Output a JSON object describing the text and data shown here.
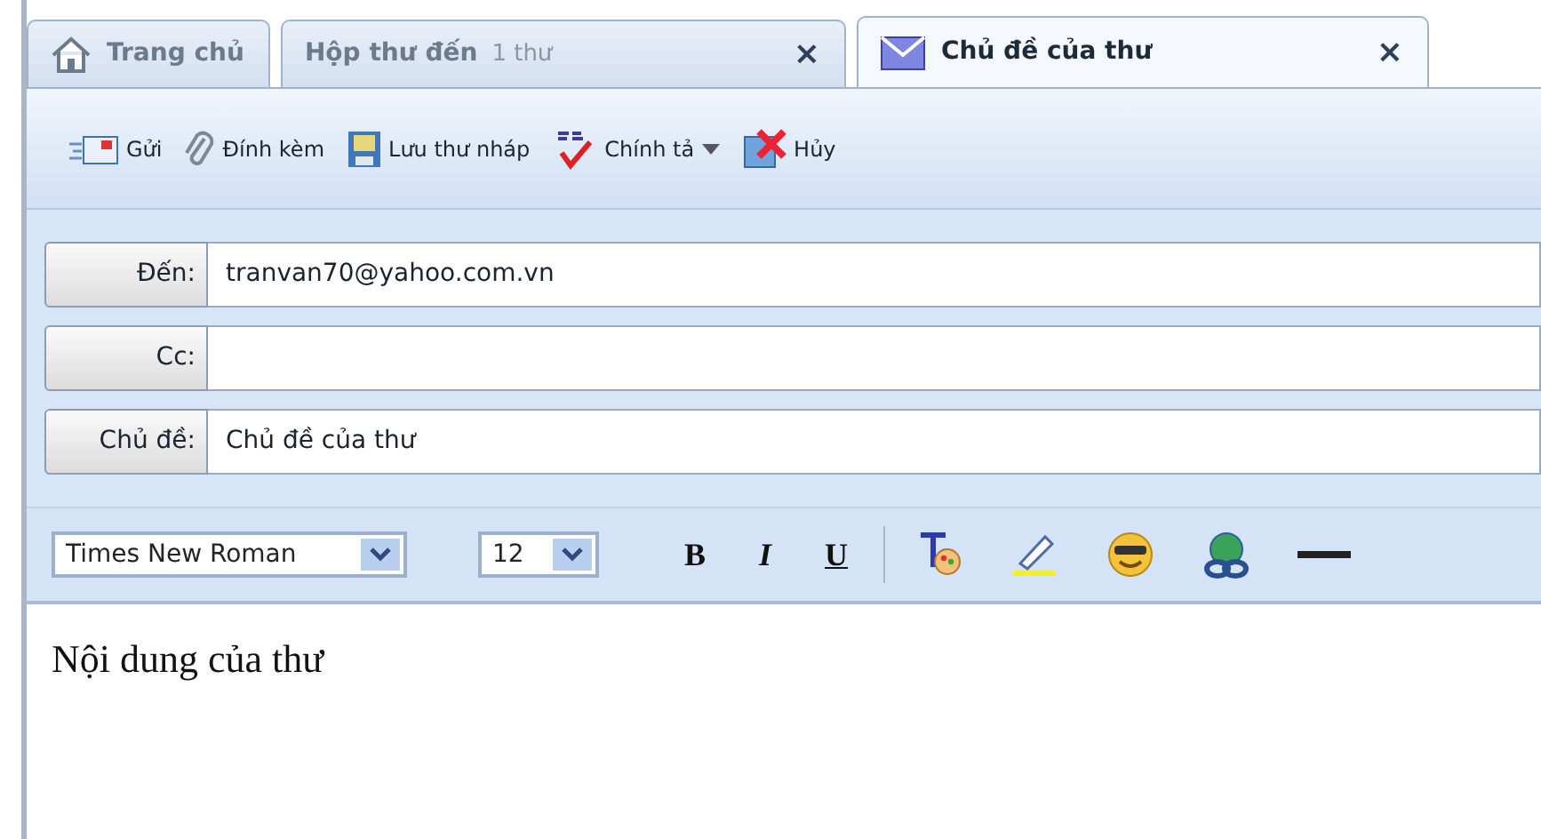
{
  "tabs": [
    {
      "kind": "home",
      "label": "Trang chủ",
      "selected": false
    },
    {
      "kind": "folder",
      "label": "Hộp thư đến",
      "count": "1 thư",
      "close": "×",
      "selected": false
    },
    {
      "kind": "message",
      "label": "Chủ đề của thư",
      "close": "×",
      "selected": true
    }
  ],
  "toolbar": [
    {
      "kind": "send",
      "label": "Gửi",
      "menu": false
    },
    {
      "kind": "attach",
      "label": "Đính kèm",
      "menu": false
    },
    {
      "kind": "save",
      "label": "Lưu thư nháp",
      "menu": false
    },
    {
      "kind": "spell",
      "label": "Chính tả",
      "menu": true
    },
    {
      "kind": "cancel",
      "label": "Hủy",
      "menu": false
    }
  ],
  "fields": [
    {
      "label": "Đến:",
      "value": "tranvan70@yahoo.com.vn"
    },
    {
      "label": "Cc:"
    },
    {
      "label": "Chủ đề:",
      "value": "Chủ đề của thư"
    }
  ],
  "format_bar": {
    "font": "Times New Roman",
    "size": "12",
    "styles": [
      {
        "kind": "bold",
        "label": "B"
      },
      {
        "kind": "italic",
        "label": "I"
      },
      {
        "kind": "underline",
        "label": "U"
      }
    ]
  },
  "body": "Nội dung của thư"
}
